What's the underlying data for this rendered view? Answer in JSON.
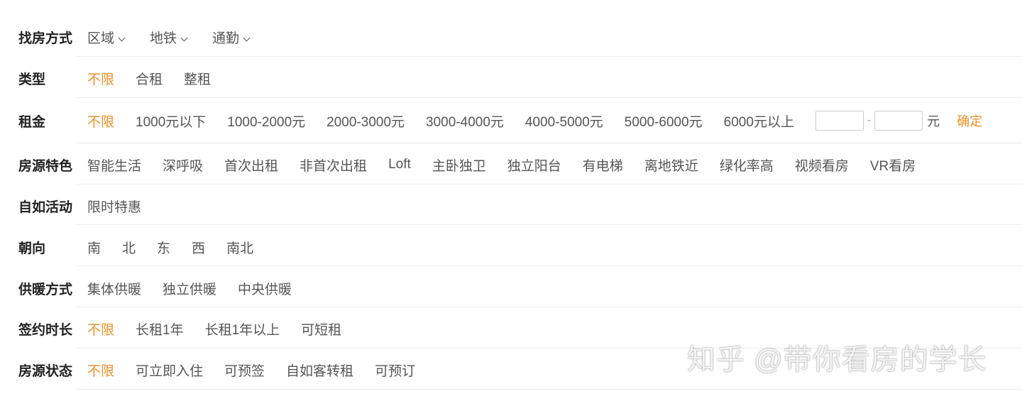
{
  "rows": {
    "method": {
      "label": "找房方式",
      "options": [
        "区域",
        "地铁",
        "通勤"
      ]
    },
    "type": {
      "label": "类型",
      "options": [
        "不限",
        "合租",
        "整租"
      ]
    },
    "rent": {
      "label": "租金",
      "options": [
        "不限",
        "1000元以下",
        "1000-2000元",
        "2000-3000元",
        "3000-4000元",
        "4000-5000元",
        "5000-6000元",
        "6000元以上"
      ],
      "min_value": "",
      "max_value": "",
      "dash": "-",
      "unit": "元",
      "confirm": "确定"
    },
    "features": {
      "label": "房源特色",
      "options": [
        "智能生活",
        "深呼吸",
        "首次出租",
        "非首次出租",
        "Loft",
        "主卧独卫",
        "独立阳台",
        "有电梯",
        "离地铁近",
        "绿化率高",
        "视频看房",
        "VR看房"
      ]
    },
    "activity": {
      "label": "自如活动",
      "options": [
        "限时特惠"
      ]
    },
    "orientation": {
      "label": "朝向",
      "options": [
        "南",
        "北",
        "东",
        "西",
        "南北"
      ]
    },
    "heating": {
      "label": "供暖方式",
      "options": [
        "集体供暖",
        "独立供暖",
        "中央供暖"
      ]
    },
    "lease": {
      "label": "签约时长",
      "options": [
        "不限",
        "长租1年",
        "长租1年以上",
        "可短租"
      ]
    },
    "status": {
      "label": "房源状态",
      "options": [
        "不限",
        "可立即入住",
        "可预签",
        "自如客转租",
        "可预订"
      ]
    }
  },
  "watermark": "知乎 @带你看房的学长",
  "colors": {
    "accent": "#e8912d",
    "label": "#222222",
    "option": "#555555",
    "divider": "#eeeeee"
  },
  "icons": {
    "dropdown": "chevron-down-icon"
  }
}
